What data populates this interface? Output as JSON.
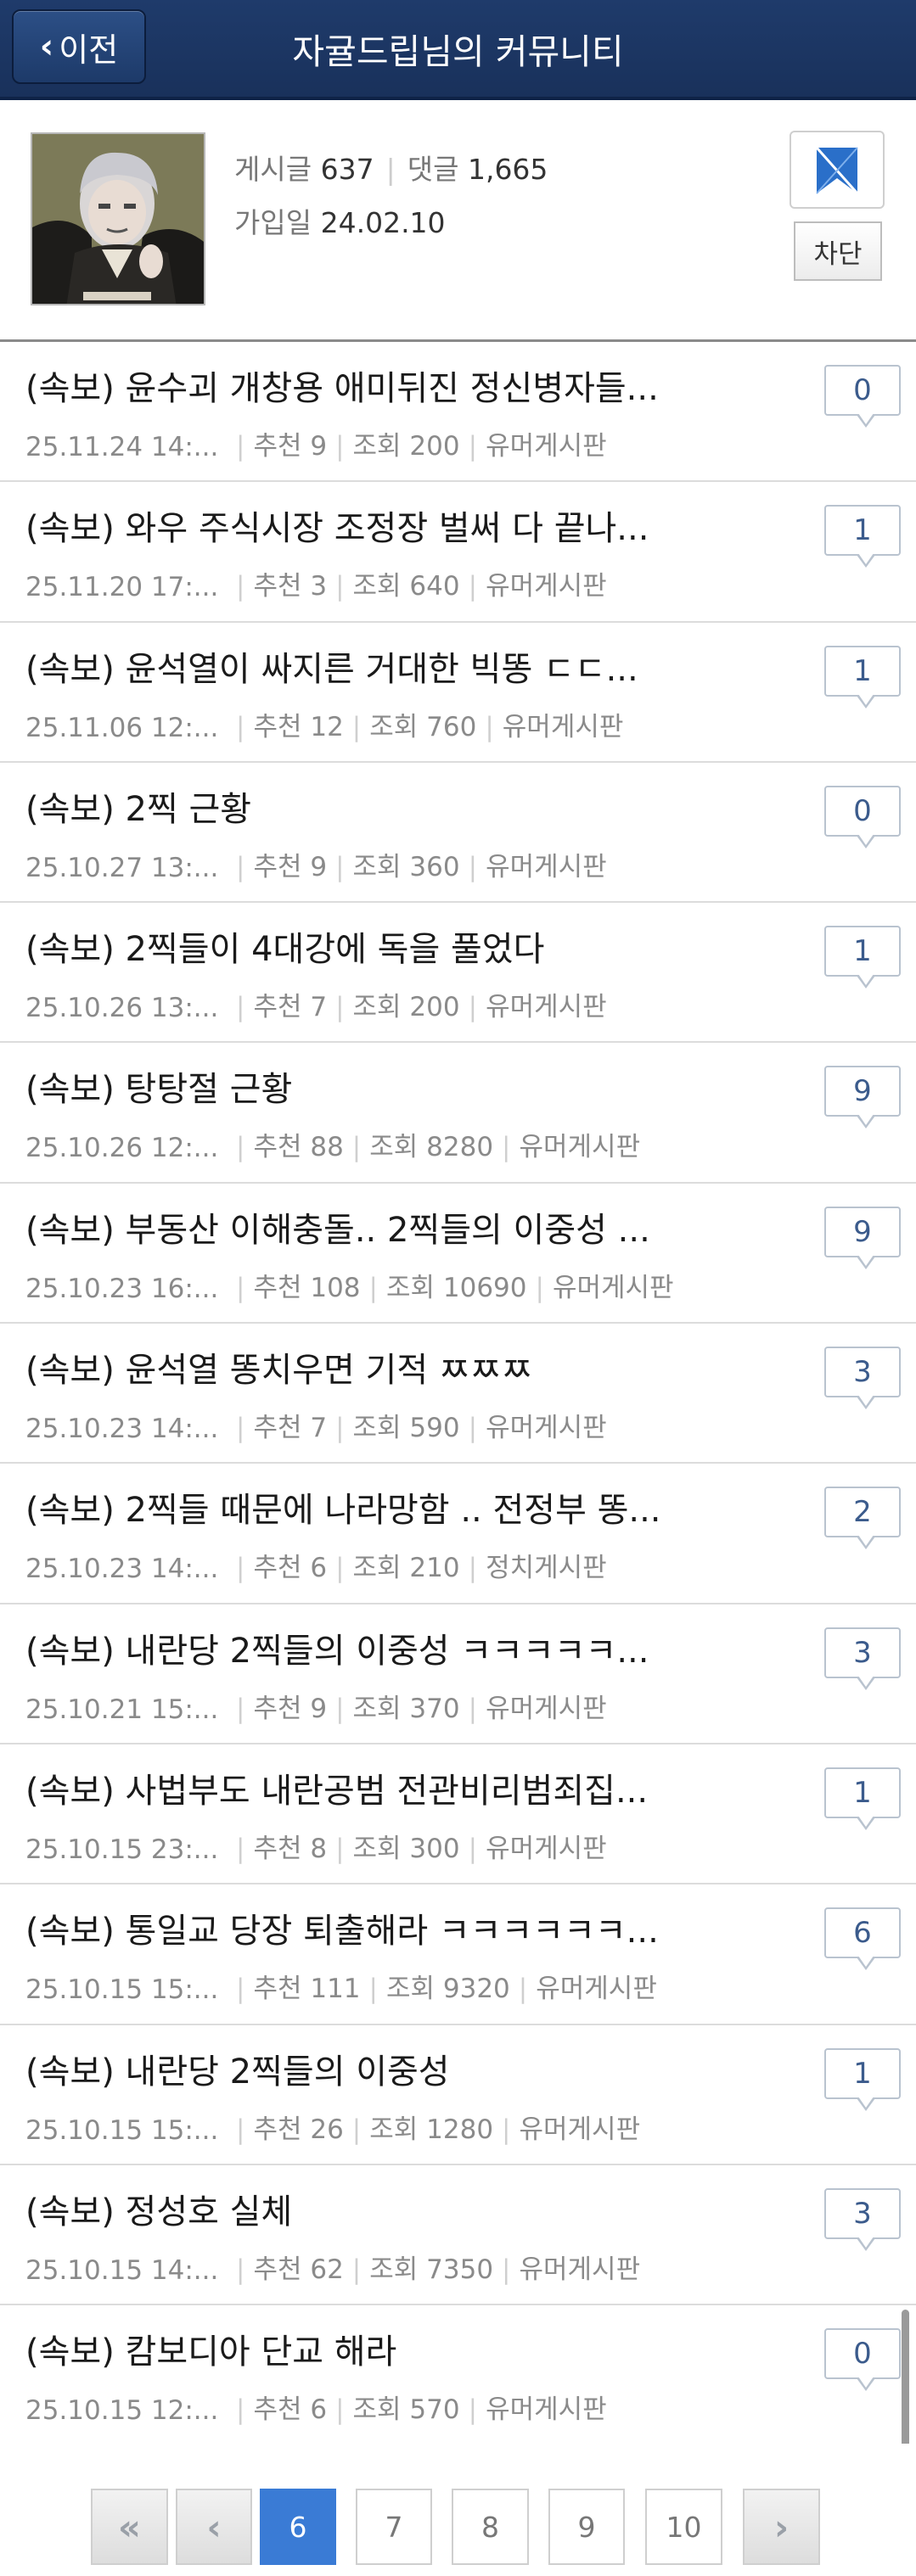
{
  "header": {
    "back_label": "이전",
    "title": "자귤드립님의 커뮤니티"
  },
  "profile": {
    "posts_label": "게시글",
    "posts_count": "637",
    "comments_label": "댓글",
    "comments_count": "1,665",
    "joined_label": "가입일",
    "joined_date": "24.02.10",
    "block_label": "차단",
    "icon": "bookmark-ribbon-icon",
    "accent_color": "#2a6fc9"
  },
  "posts": [
    {
      "title": "(속보) 윤수괴 개창용 애미뒤진 정신병자들...",
      "date": "25.11.24  14:...",
      "recommend": "추천 9",
      "views": "조회 200",
      "board": "유머게시판",
      "comments": "0"
    },
    {
      "title": "(속보) 와우 주식시장 조정장 벌써 다 끝나...",
      "date": "25.11.20  17:...",
      "recommend": "추천 3",
      "views": "조회 640",
      "board": "유머게시판",
      "comments": "1"
    },
    {
      "title": "(속보) 윤석열이 싸지른 거대한 빅똥 ㄷㄷ...",
      "date": "25.11.06  12:...",
      "recommend": "추천 12",
      "views": "조회 760",
      "board": "유머게시판",
      "comments": "1"
    },
    {
      "title": "(속보) 2찍 근황",
      "date": "25.10.27  13:...",
      "recommend": "추천 9",
      "views": "조회 360",
      "board": "유머게시판",
      "comments": "0"
    },
    {
      "title": "(속보) 2찍들이 4대강에 독을 풀었다",
      "date": "25.10.26  13:...",
      "recommend": "추천 7",
      "views": "조회 200",
      "board": "유머게시판",
      "comments": "1"
    },
    {
      "title": "(속보) 탕탕절 근황",
      "date": "25.10.26  12:...",
      "recommend": "추천 88",
      "views": "조회 8280",
      "board": "유머게시판",
      "comments": "9"
    },
    {
      "title": "(속보) 부동산 이해충돌.. 2찍들의 이중성 ...",
      "date": "25.10.23  16:...",
      "recommend": "추천 108",
      "views": "조회 10690",
      "board": "유머게시판",
      "comments": "9"
    },
    {
      "title": "(속보) 윤석열 똥치우면 기적 ㅉㅉㅉ",
      "date": "25.10.23  14:...",
      "recommend": "추천 7",
      "views": "조회 590",
      "board": "유머게시판",
      "comments": "3"
    },
    {
      "title": "(속보) 2찍들 때문에 나라망함 .. 전정부 똥...",
      "date": "25.10.23  14:...",
      "recommend": "추천 6",
      "views": "조회 210",
      "board": "정치게시판",
      "comments": "2"
    },
    {
      "title": "(속보) 내란당 2찍들의 이중성 ㅋㅋㅋㅋㅋ...",
      "date": "25.10.21  15:...",
      "recommend": "추천 9",
      "views": "조회 370",
      "board": "유머게시판",
      "comments": "3"
    },
    {
      "title": "(속보) 사법부도 내란공범 전관비리범죄집...",
      "date": "25.10.15  23:...",
      "recommend": "추천 8",
      "views": "조회 300",
      "board": "유머게시판",
      "comments": "1"
    },
    {
      "title": "(속보) 통일교 당장 퇴출해라 ㅋㅋㅋㅋㅋㅋ...",
      "date": "25.10.15  15:...",
      "recommend": "추천 111",
      "views": "조회 9320",
      "board": "유머게시판",
      "comments": "6"
    },
    {
      "title": "(속보) 내란당 2찍들의 이중성",
      "date": "25.10.15  15:...",
      "recommend": "추천 26",
      "views": "조회 1280",
      "board": "유머게시판",
      "comments": "1"
    },
    {
      "title": "(속보) 정성호 실체",
      "date": "25.10.15  14:...",
      "recommend": "추천 62",
      "views": "조회 7350",
      "board": "유머게시판",
      "comments": "3"
    },
    {
      "title": "(속보) 캄보디아 단교 해라",
      "date": "25.10.15  12:...",
      "recommend": "추천 6",
      "views": "조회 570",
      "board": "유머게시판",
      "comments": "0"
    }
  ],
  "pagination": {
    "first_icon": "double-chevron-left-icon",
    "prev_icon": "chevron-left-icon",
    "next_icon": "chevron-right-icon",
    "pages": [
      "6",
      "7",
      "8",
      "9",
      "10"
    ],
    "current": "6"
  }
}
